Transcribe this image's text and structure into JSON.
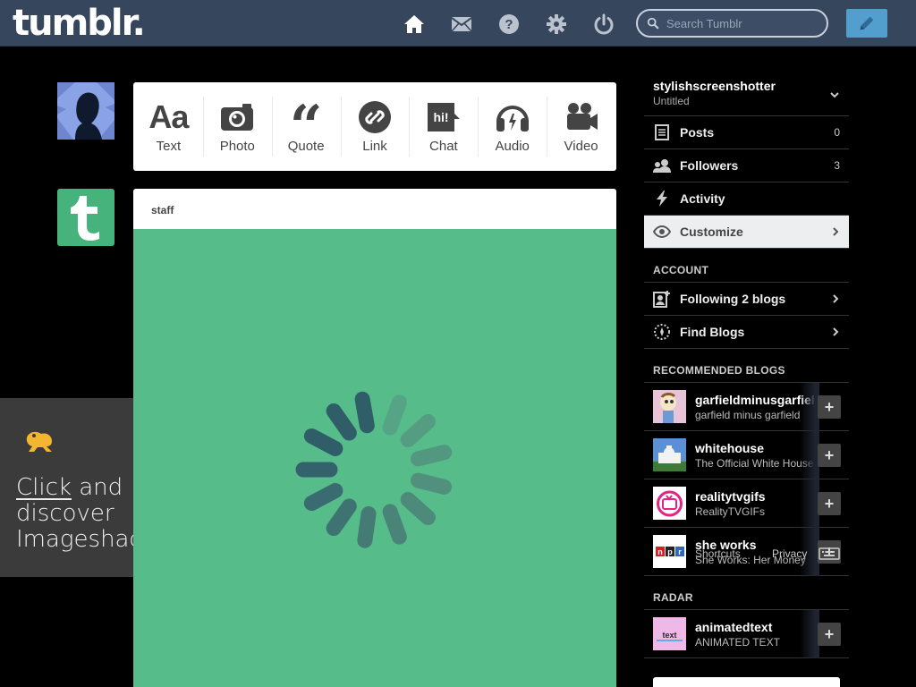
{
  "header": {
    "logo": "tumblr.",
    "search_placeholder": "Search Tumblr",
    "icons": [
      "home-icon",
      "mail-icon",
      "help-icon",
      "gear-icon",
      "power-icon",
      "pencil-icon"
    ]
  },
  "post_types": [
    {
      "label": "Text",
      "icon": "text-icon"
    },
    {
      "label": "Photo",
      "icon": "camera-icon"
    },
    {
      "label": "Quote",
      "icon": "quote-icon"
    },
    {
      "label": "Link",
      "icon": "link-icon"
    },
    {
      "label": "Chat",
      "icon": "chat-icon"
    },
    {
      "label": "Audio",
      "icon": "headphones-icon"
    },
    {
      "label": "Video",
      "icon": "video-camera-icon"
    }
  ],
  "chat_badge": "hi!",
  "post": {
    "author": "staff"
  },
  "imageshack": {
    "line1_link": "Click",
    "line1_rest": " and",
    "line2": "discover",
    "line3": "Imageshack"
  },
  "sidebar": {
    "blog_name": "stylishscreenshotter",
    "blog_title": "Untitled",
    "items": [
      {
        "label": "Posts",
        "count": "0"
      },
      {
        "label": "Followers",
        "count": "3"
      },
      {
        "label": "Activity"
      },
      {
        "label": "Customize"
      }
    ],
    "account_title": "ACCOUNT",
    "account_items": [
      {
        "label": "Following 2 blogs"
      },
      {
        "label": "Find Blogs"
      }
    ],
    "recommended_title": "RECOMMENDED BLOGS",
    "recommended": [
      {
        "name": "garfieldminusgarfield",
        "desc": "garfield minus garfield"
      },
      {
        "name": "whitehouse",
        "desc": "The Official White House"
      },
      {
        "name": "realitytvgifs",
        "desc": "RealityTVGIFs"
      },
      {
        "name": "she works",
        "desc": "She Works: Her Money"
      }
    ],
    "popup": {
      "left": "Shortcuts",
      "right": "Privacy"
    },
    "radar_title": "RADAR",
    "radar": [
      {
        "name": "animatedtext",
        "desc": "ANIMATED TEXT"
      }
    ]
  },
  "colors": {
    "header_bg": "#36465d",
    "accent": "#529ecc",
    "post_green": "#56bc8a"
  }
}
